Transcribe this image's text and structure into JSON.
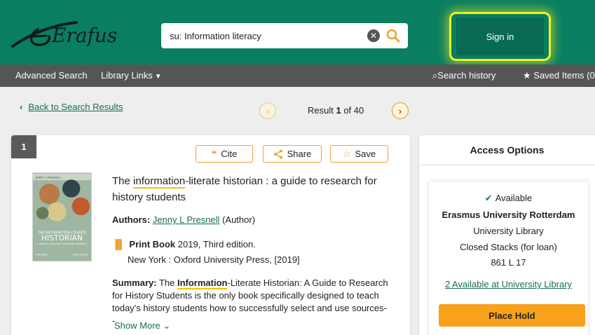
{
  "header": {
    "logo_text": "Erafus",
    "search_value": "su: Information literacy",
    "sign_in_label": "Sign in"
  },
  "nav": {
    "advanced_search": "Advanced Search",
    "library_links": "Library Links",
    "search_history": "Search history",
    "saved_items": "Saved Items (0"
  },
  "results_nav": {
    "back_label": "Back to Search Results",
    "result_prefix": "Result ",
    "result_current": "1",
    "result_suffix": " of 40"
  },
  "record": {
    "number": "1",
    "cite_label": "Cite",
    "share_label": "Share",
    "save_label": "Save",
    "title_pre": "The ",
    "title_hl": "information",
    "title_post": "-literate historian : a guide to research for history students",
    "authors_label": "Authors:",
    "author_name": "Jenny L Presnell",
    "author_role": "(Author)",
    "format_label": "Print Book",
    "format_detail": "2019, Third edition.",
    "publisher": "New York : Oxford University Press, [2019]",
    "summary_label": "Summary:",
    "summary_pre": "The ",
    "summary_hl": "Information",
    "summary_post": "-Literate Historian: A Guide to Research for History Students is the only book specifically designed to teach today's history students how to successfully select and use sources--",
    "show_more": "Show More",
    "cover_text": {
      "top": "JENNY L PRESNELL",
      "line1": "THE INFORMATION-LITERATE",
      "line2": "HISTORIAN",
      "line3": "A GUIDE TO RESEARCH FOR HISTORY STUDENTS",
      "publisher": "OXFORD",
      "edition": "THIRD EDITION"
    }
  },
  "access": {
    "title": "Access Options",
    "status": "Available",
    "institution": "Erasmus University Rotterdam",
    "library": "University Library",
    "location": "Closed Stacks (for loan)",
    "call_number": "861 L 17",
    "available_link": "2 Available at University Library",
    "place_hold": "Place Hold"
  }
}
